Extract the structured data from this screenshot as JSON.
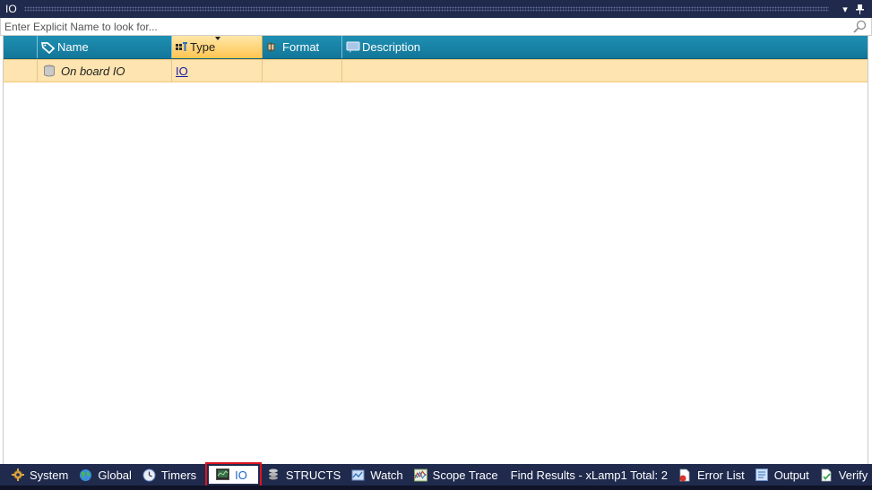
{
  "window": {
    "title": "IO",
    "dropdown_glyph": "▾",
    "pin_glyph": "📌"
  },
  "search": {
    "placeholder": "Enter Explicit Name to look for..."
  },
  "grid": {
    "columns": [
      {
        "label": "Name",
        "icon": "tag-icon"
      },
      {
        "label": "Type",
        "icon": "type-icon",
        "sorted": true
      },
      {
        "label": "Format",
        "icon": "format-icon"
      },
      {
        "label": "Description",
        "icon": "comment-icon"
      }
    ],
    "rows": [
      {
        "name": "On board IO",
        "type": "IO",
        "format": "",
        "description": "",
        "icon": "database-icon"
      }
    ]
  },
  "tabs": [
    {
      "label": "System",
      "icon": "gear-icon"
    },
    {
      "label": "Global",
      "icon": "globe-icon"
    },
    {
      "label": "Timers",
      "icon": "clock-icon"
    },
    {
      "label": "IO",
      "icon": "monitor-icon",
      "active": true
    },
    {
      "label": "STRUCTS",
      "icon": "stack-icon"
    },
    {
      "label": "Watch",
      "icon": "watch-icon"
    },
    {
      "label": "Scope Trace",
      "icon": "scope-icon"
    },
    {
      "label": "Find Results - xLamp1 Total: 2",
      "icon": ""
    },
    {
      "label": "Error List",
      "icon": "error-list-icon"
    },
    {
      "label": "Output",
      "icon": "output-icon"
    },
    {
      "label": "Verify",
      "icon": "verify-icon"
    }
  ],
  "colors": {
    "header_bg": "#1a86aa",
    "selected_header": "#ffc552",
    "selected_row": "#fde4b0",
    "titlebar_bg": "#1f2a4d",
    "active_tab_outline": "#e0141e",
    "link": "#1a1aa6"
  }
}
